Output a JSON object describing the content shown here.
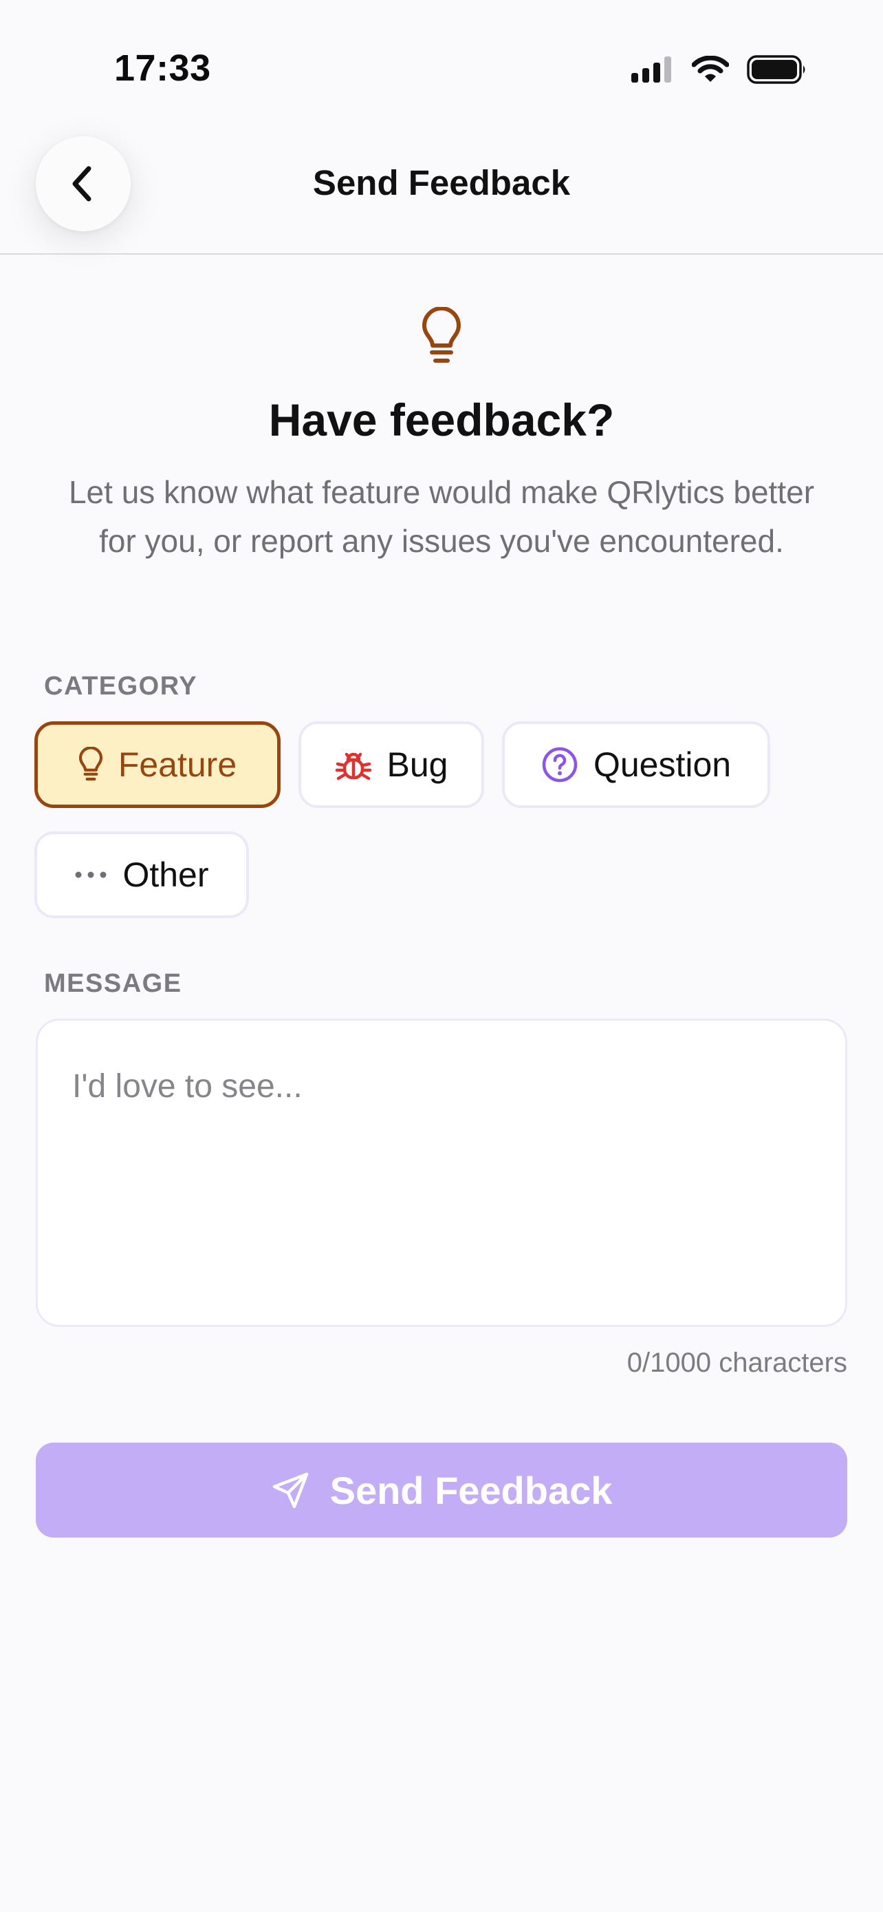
{
  "status_bar": {
    "time": "17:33",
    "icons": [
      "cellular-signal-icon",
      "wifi-icon",
      "battery-icon"
    ]
  },
  "header": {
    "title": "Send Feedback",
    "back_icon": "chevron-left-icon"
  },
  "hero": {
    "icon": "lightbulb-icon",
    "title": "Have feedback?",
    "subtitle": "Let us know what feature would make QRlytics better for you, or report any issues you've encountered."
  },
  "category": {
    "label": "CATEGORY",
    "selected": "Feature",
    "options": [
      {
        "label": "Feature",
        "icon": "lightbulb-icon",
        "color": "#98460f"
      },
      {
        "label": "Bug",
        "icon": "bug-icon",
        "color": "#e0312f"
      },
      {
        "label": "Question",
        "icon": "question-circle-icon",
        "color": "#8d55e6"
      },
      {
        "label": "Other",
        "icon": "more-dots-icon",
        "color": "#6f6f75"
      }
    ]
  },
  "message": {
    "label": "MESSAGE",
    "value": "",
    "placeholder": "I'd love to see...",
    "char_count": "0/1000 characters"
  },
  "submit": {
    "label": "Send Feedback",
    "icon": "send-icon"
  },
  "colors": {
    "background": "#fafafd",
    "selected_chip_bg": "#fdf0c4",
    "selected_chip_border": "#98460f",
    "button_bg": "#c3adf6"
  }
}
